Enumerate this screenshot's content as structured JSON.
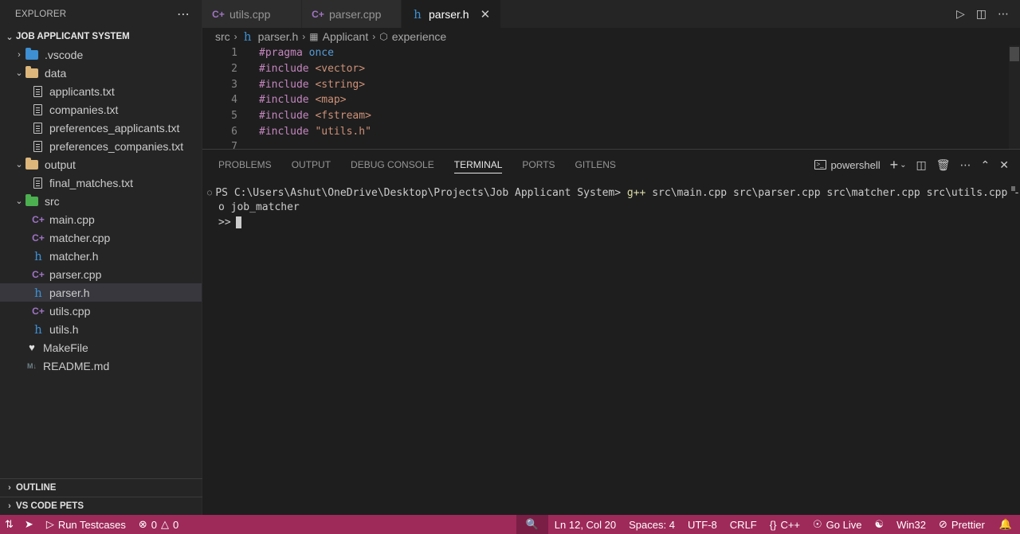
{
  "sidebar": {
    "title": "EXPLORER",
    "more": "⋯",
    "root": "JOB APPLICANT SYSTEM",
    "tree": [
      {
        "label": ".vscode",
        "kind": "folder-vscode",
        "depth": 1,
        "open": false
      },
      {
        "label": "data",
        "kind": "folder",
        "depth": 1,
        "open": true
      },
      {
        "label": "applicants.txt",
        "kind": "txt",
        "depth": 2
      },
      {
        "label": "companies.txt",
        "kind": "txt",
        "depth": 2
      },
      {
        "label": "preferences_applicants.txt",
        "kind": "txt",
        "depth": 2
      },
      {
        "label": "preferences_companies.txt",
        "kind": "txt",
        "depth": 2
      },
      {
        "label": "output",
        "kind": "folder",
        "depth": 1,
        "open": true
      },
      {
        "label": "final_matches.txt",
        "kind": "txt",
        "depth": 2
      },
      {
        "label": "src",
        "kind": "folder-src",
        "depth": 1,
        "open": true
      },
      {
        "label": "main.cpp",
        "kind": "cpp",
        "depth": 2
      },
      {
        "label": "matcher.cpp",
        "kind": "cpp",
        "depth": 2
      },
      {
        "label": "matcher.h",
        "kind": "h",
        "depth": 2
      },
      {
        "label": "parser.cpp",
        "kind": "cpp",
        "depth": 2
      },
      {
        "label": "parser.h",
        "kind": "h",
        "depth": 2,
        "active": true
      },
      {
        "label": "utils.cpp",
        "kind": "cpp",
        "depth": 2
      },
      {
        "label": "utils.h",
        "kind": "h",
        "depth": 2
      },
      {
        "label": "MakeFile",
        "kind": "make",
        "depth": 1
      },
      {
        "label": "README.md",
        "kind": "md",
        "depth": 1
      }
    ],
    "outline": "OUTLINE",
    "pets": "VS CODE PETS"
  },
  "tabs": [
    {
      "label": "utils.cpp",
      "kind": "cpp",
      "active": false
    },
    {
      "label": "parser.cpp",
      "kind": "cpp",
      "active": false
    },
    {
      "label": "parser.h",
      "kind": "h",
      "active": true
    }
  ],
  "breadcrumb": {
    "folder": "src",
    "file": "parser.h",
    "symbol1": "Applicant",
    "symbol2": "experience"
  },
  "editor": {
    "lines": [
      {
        "n": "1",
        "text": "#pragma once"
      },
      {
        "n": "2",
        "text": "#include <vector>"
      },
      {
        "n": "3",
        "text": "#include <string>"
      },
      {
        "n": "4",
        "text": "#include <map>"
      },
      {
        "n": "5",
        "text": "#include <fstream>"
      },
      {
        "n": "6",
        "text": "#include \"utils.h\""
      },
      {
        "n": "7",
        "text": ""
      }
    ]
  },
  "panel": {
    "tabs": [
      "PROBLEMS",
      "OUTPUT",
      "DEBUG CONSOLE",
      "TERMINAL",
      "PORTS",
      "GITLENS"
    ],
    "active_tab": "TERMINAL",
    "shell": "powershell",
    "terminal": {
      "prompt": "PS C:\\Users\\Ashut\\OneDrive\\Desktop\\Projects\\Job Applicant System> ",
      "command": "g++",
      "args": " src\\main.cpp src\\parser.cpp src\\matcher.cpp src\\utils.cpp -",
      "wrap": "o job_matcher",
      "continuation": ">>"
    }
  },
  "status": {
    "run_testcases": "Run Testcases",
    "errors": "0",
    "warnings": "0",
    "position": "Ln 12, Col 20",
    "spaces": "Spaces: 4",
    "encoding": "UTF-8",
    "eol": "CRLF",
    "language": "C++",
    "golive": "Go Live",
    "platform": "Win32",
    "prettier": "Prettier"
  },
  "colors": {
    "statusbar": "#9e2a5a",
    "cpp_icon": "#a074c4",
    "h_icon": "#3d8fd1",
    "folder": "#dcb67a"
  }
}
